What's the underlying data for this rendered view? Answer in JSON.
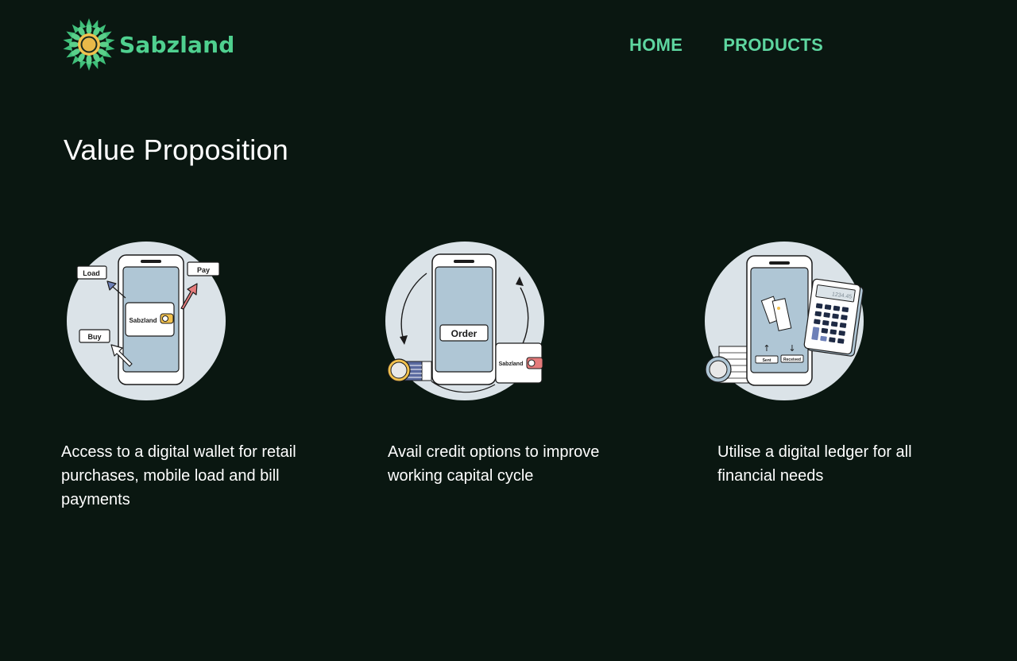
{
  "brand": {
    "name": "Sabzland"
  },
  "nav": {
    "home": "HOME",
    "products": "PRODUCTS"
  },
  "section": {
    "title": "Value Proposition"
  },
  "cards": [
    {
      "labels": {
        "load": "Load",
        "pay": "Pay",
        "buy": "Buy",
        "wallet": "Sabzland"
      },
      "text": "Access to a digital wallet for retail purchases, mobile load and bill payments"
    },
    {
      "labels": {
        "order": "Order",
        "wallet": "Sabzland"
      },
      "text": "Avail credit options to improve working capital cycle"
    },
    {
      "labels": {
        "sent": "Sent",
        "received": "Received",
        "display": "1234.45"
      },
      "text": "Utilise a digital ledger for all financial needs"
    }
  ],
  "colors": {
    "background": "#0a1711",
    "accent": "#4fd08f",
    "nav": "#5ed6a0",
    "circle": "#dbe3e8"
  }
}
